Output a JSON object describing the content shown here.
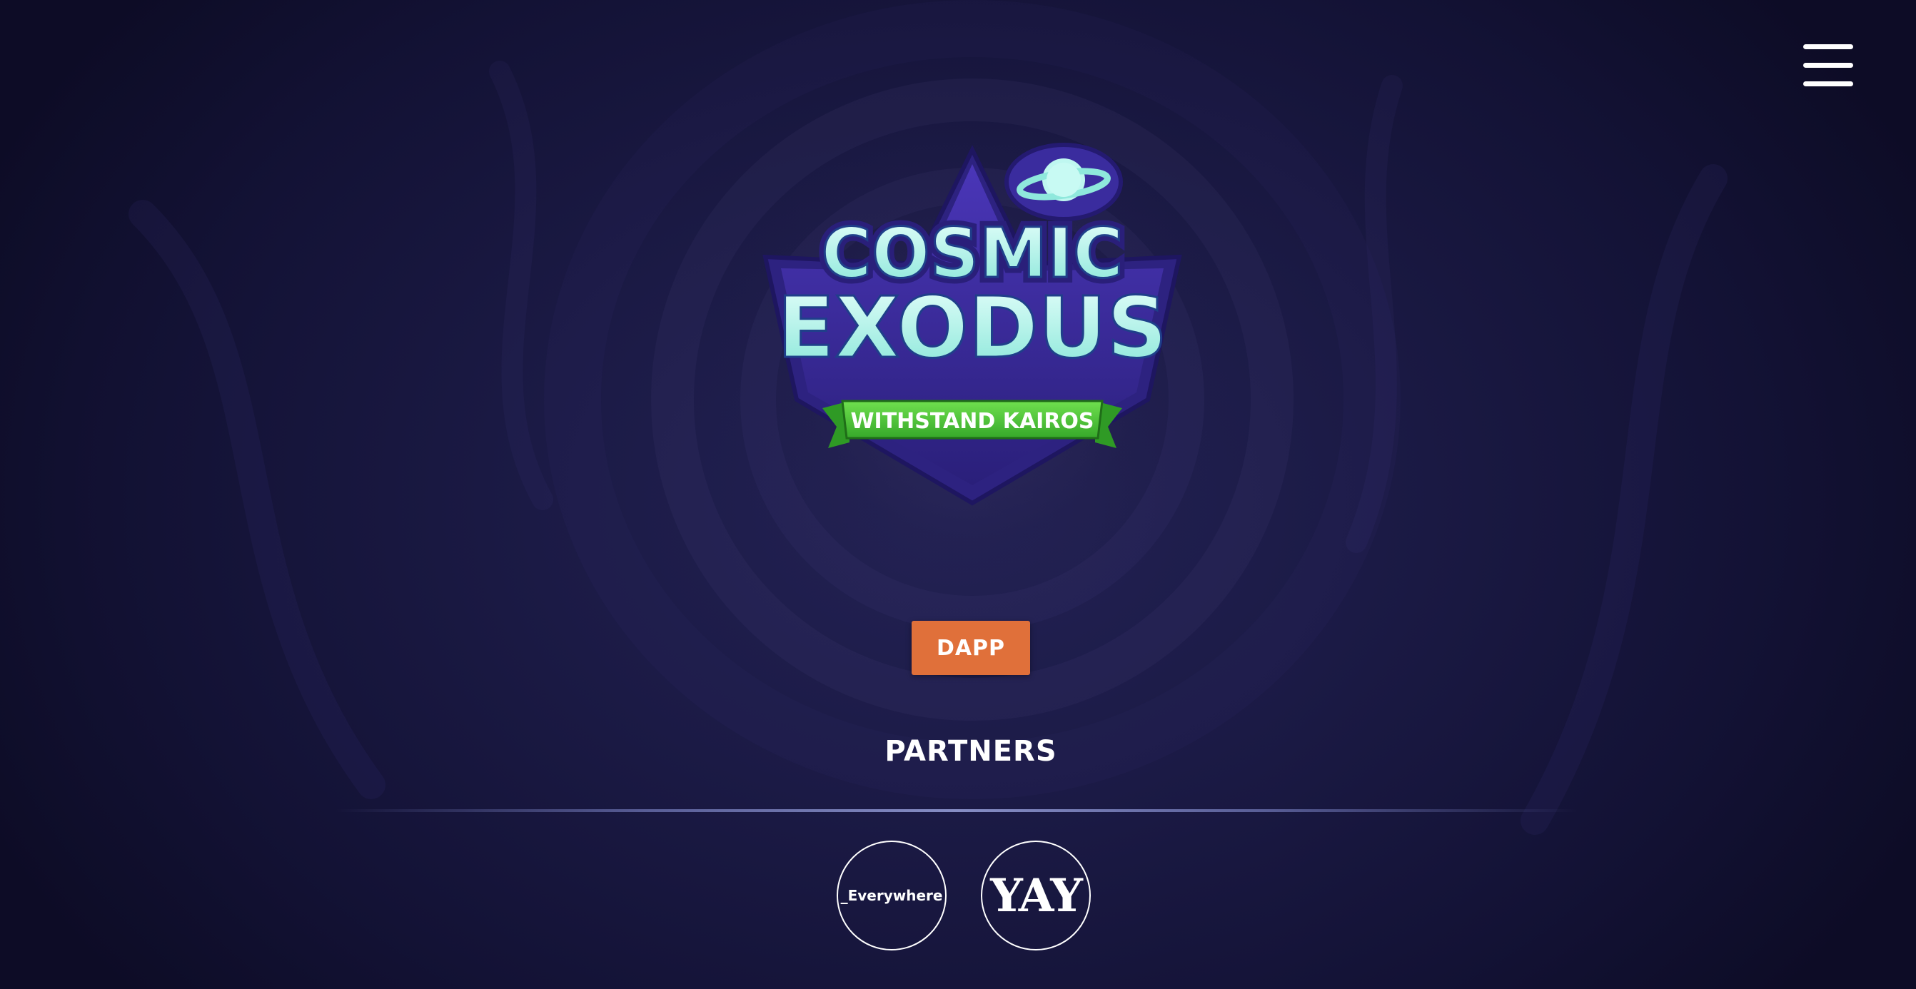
{
  "logo": {
    "title_line1": "COSMIC",
    "title_line2": "EXODUS",
    "tagline": "WITHSTAND KAIROS"
  },
  "hero": {
    "dapp_label": "DAPP"
  },
  "partners": {
    "title": "PARTNERS",
    "items": [
      {
        "name": "_Everywhere"
      },
      {
        "name": "YAY"
      }
    ]
  },
  "colors": {
    "background": "#1b1a45",
    "accent_button": "#e0703a",
    "logo_purple": "#3b2a9a",
    "logo_cyan": "#bff7f0",
    "ribbon_green": "#4cc73a"
  },
  "icons": {
    "menu": "hamburger-menu-icon",
    "logo_planet": "planet-icon"
  }
}
